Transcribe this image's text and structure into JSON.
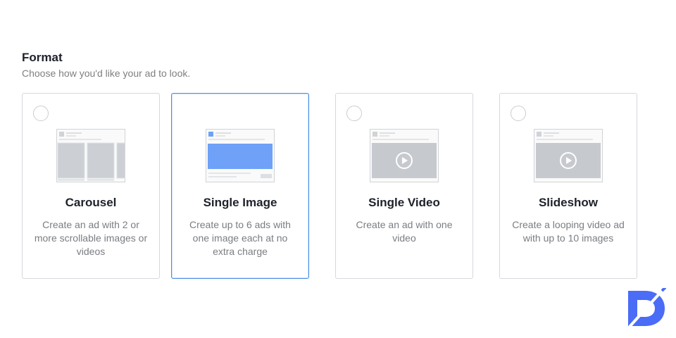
{
  "format": {
    "title": "Format",
    "subtitle": "Choose how you'd like your ad to look."
  },
  "options": [
    {
      "title": "Carousel",
      "description": "Create an ad with 2 or more scrollable images or videos",
      "selected": false,
      "thumbnail": "carousel-thumbnail-icon"
    },
    {
      "title": "Single Image",
      "description": "Create up to 6 ads with one image each at no extra charge",
      "selected": true,
      "thumbnail": "single-image-thumbnail-icon"
    },
    {
      "title": "Single Video",
      "description": "Create an ad with one video",
      "selected": false,
      "thumbnail": "video-thumbnail-icon"
    },
    {
      "title": "Slideshow",
      "description": "Create a looping video ad with up to 10 images",
      "selected": false,
      "thumbnail": "slideshow-thumbnail-icon"
    }
  ],
  "colors": {
    "selected_border": "#4a90e2",
    "image_placeholder": "#6ea1f7",
    "logo": "#4a6cf7"
  }
}
